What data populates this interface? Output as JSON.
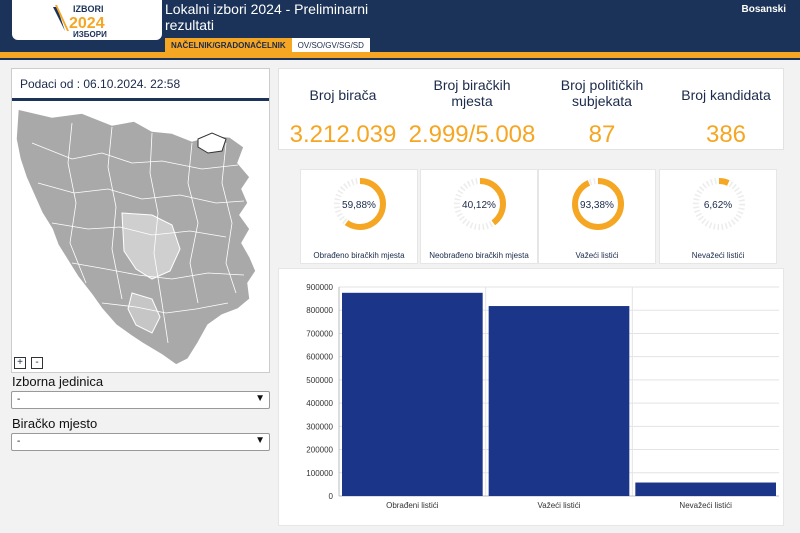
{
  "header": {
    "logo_text_top": "IZBORI",
    "logo_year": "2024",
    "logo_text_bottom": "ИЗБОРИ",
    "title": "Lokalni izbori 2024 - Preliminarni rezultati",
    "language": "Bosanski",
    "tabs": [
      {
        "label": "NAČELNIK/GRADONAČELNIK",
        "active": true
      },
      {
        "label": "OV/SO/GV/SG/SD",
        "active": false
      }
    ]
  },
  "colors": {
    "navy": "#1b3358",
    "accent": "#f5a623",
    "bar": "#1b3588"
  },
  "left": {
    "date_text": "Podaci od : 06.10.2024. 22:58",
    "zoom_in": "+",
    "zoom_out": "-",
    "unit_label": "Izborna jedinica",
    "unit_value": "-",
    "station_label": "Biračko mjesto",
    "station_value": "-"
  },
  "stats": [
    {
      "label": "Broj birača",
      "value": "3.212.039"
    },
    {
      "label": "Broj biračkih mjesta",
      "value": "2.999/5.008"
    },
    {
      "label": "Broj političkih subjekata",
      "value": "87"
    },
    {
      "label": "Broj kandidata",
      "value": "386"
    }
  ],
  "gauges": [
    {
      "label": "Obrađeno biračkih mjesta",
      "text": "59,88%",
      "fraction": 0.5988
    },
    {
      "label": "Neobrađeno biračkih mjesta",
      "text": "40,12%",
      "fraction": 0.4012
    },
    {
      "label": "Važeći listići",
      "text": "93,38%",
      "fraction": 0.9338
    },
    {
      "label": "Nevažeći listići",
      "text": "6,62%",
      "fraction": 0.0662
    }
  ],
  "chart_data": {
    "type": "bar",
    "categories": [
      "Obrađeni listići",
      "Važeći listići",
      "Nevažeći listići"
    ],
    "values": [
      875000,
      818000,
      58000
    ],
    "ylim": [
      0,
      900000
    ],
    "yticks": [
      "0",
      "100000",
      "200000",
      "300000",
      "400000",
      "500000",
      "600000",
      "700000",
      "800000",
      "900000"
    ],
    "title": "",
    "xlabel": "",
    "ylabel": ""
  }
}
